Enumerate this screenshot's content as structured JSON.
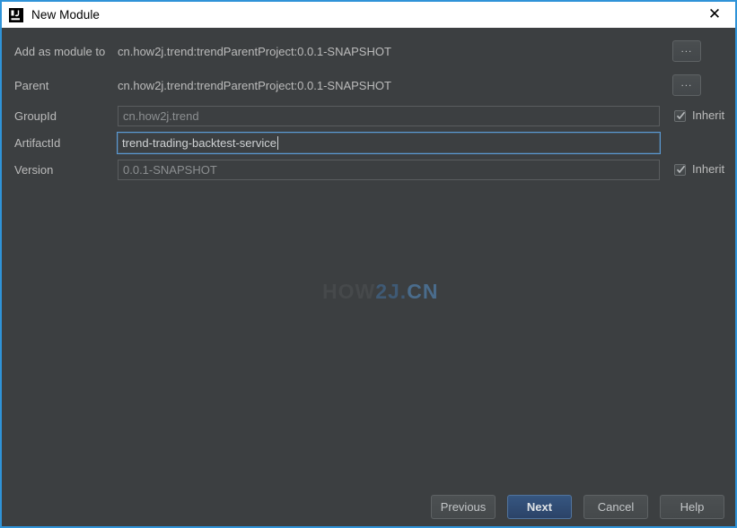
{
  "window": {
    "title": "New Module",
    "app_icon": "intellij-idea-icon",
    "close_icon": "close-icon",
    "accent_border_color": "#2f93d8",
    "background_color": "#3c3f41"
  },
  "form": {
    "rows": [
      {
        "label": "Add as module to",
        "value": "cn.how2j.trend:trendParentProject:0.0.1-SNAPSHOT",
        "browse_label": "...",
        "type": "static"
      },
      {
        "label": "Parent",
        "value": "cn.how2j.trend:trendParentProject:0.0.1-SNAPSHOT",
        "browse_label": "...",
        "type": "static"
      },
      {
        "label": "GroupId",
        "value": "cn.how2j.trend",
        "type": "field",
        "focused": false,
        "inherit_label": "Inherit",
        "inherit_checked": true
      },
      {
        "label": "ArtifactId",
        "value": "trend-trading-backtest-service",
        "type": "field",
        "focused": true,
        "inherit_label": "",
        "inherit_checked": false
      },
      {
        "label": "Version",
        "value": "0.0.1-SNAPSHOT",
        "type": "field",
        "focused": false,
        "inherit_label": "Inherit",
        "inherit_checked": true
      }
    ]
  },
  "watermark": {
    "part1": "HOW",
    "part2": "2J.",
    "part3": "CN"
  },
  "footer": {
    "buttons": [
      {
        "label": "Previous",
        "default": false
      },
      {
        "label": "Next",
        "default": true
      },
      {
        "label": "Cancel",
        "default": false
      },
      {
        "label": "Help",
        "default": false
      }
    ]
  }
}
